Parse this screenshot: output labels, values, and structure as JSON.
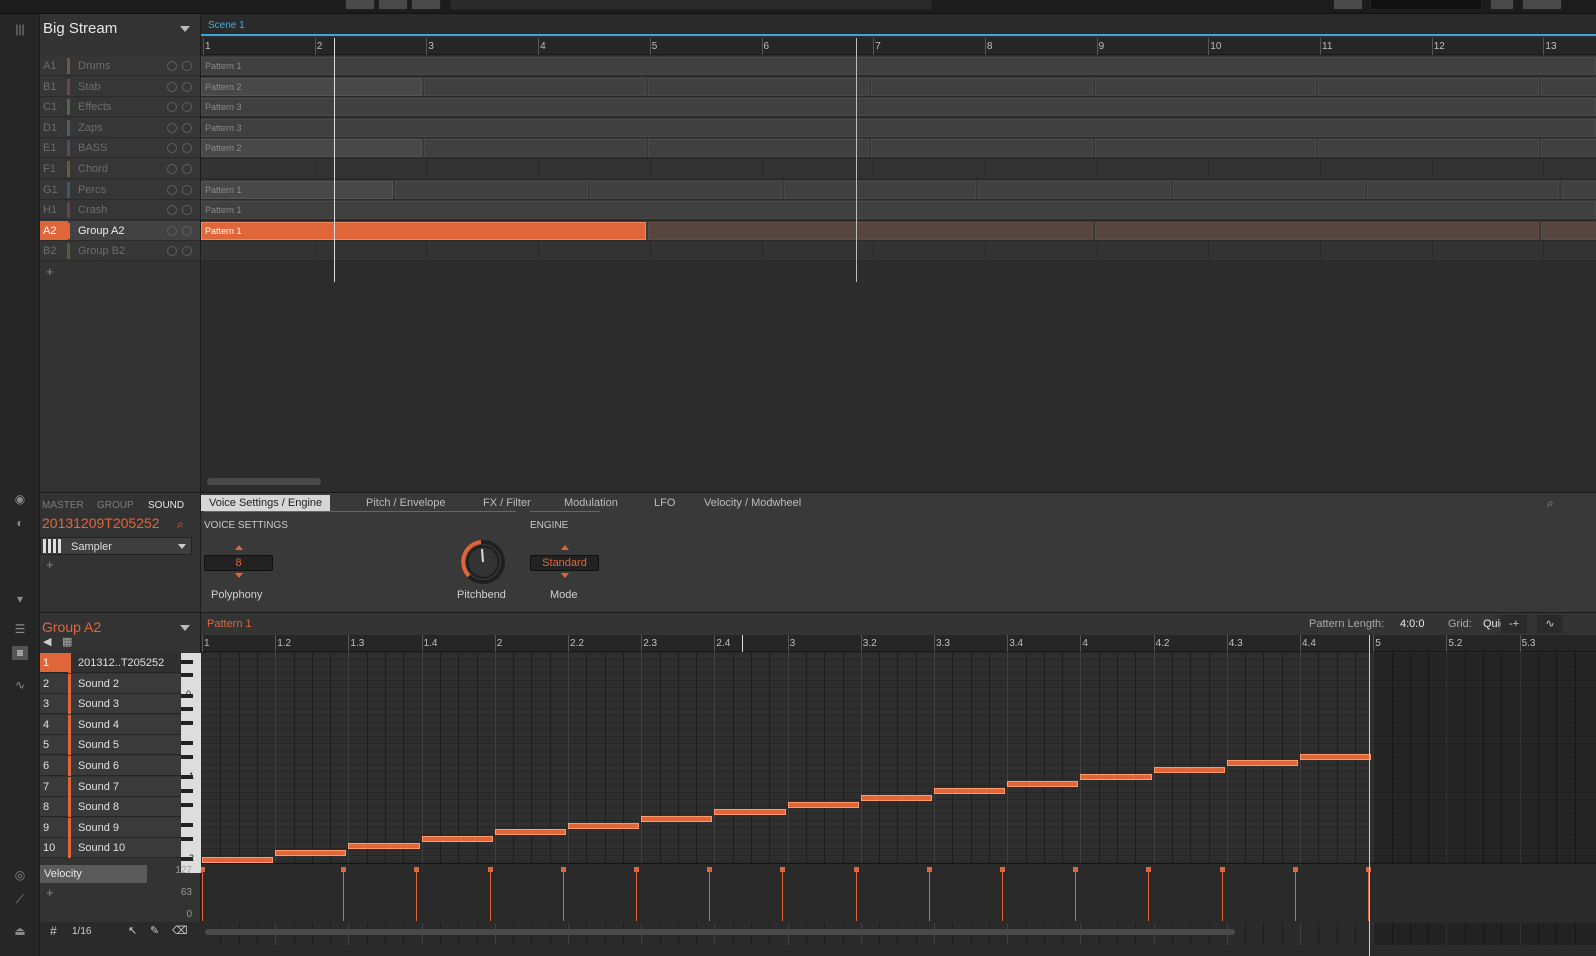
{
  "arranger": {
    "project_title": "Big Stream",
    "scene_label": "Scene 1",
    "bars": [
      "1",
      "2",
      "3",
      "4",
      "5",
      "6",
      "7",
      "8",
      "9",
      "10",
      "11",
      "12",
      "13"
    ],
    "groups": [
      {
        "id": "A1",
        "name": "Drums",
        "color": "#6b5a4a"
      },
      {
        "id": "B1",
        "name": "Stab",
        "color": "#6a4a44"
      },
      {
        "id": "C1",
        "name": "Effects",
        "color": "#4e6a4a"
      },
      {
        "id": "D1",
        "name": "Zaps",
        "color": "#4a5d6a"
      },
      {
        "id": "E1",
        "name": "BASS",
        "color": "#5a4a6a"
      },
      {
        "id": "F1",
        "name": "Chord",
        "color": "#6a5a3a"
      },
      {
        "id": "G1",
        "name": "Percs",
        "color": "#3a5a6a"
      },
      {
        "id": "H1",
        "name": "Crash",
        "color": "#5a4a4a"
      },
      {
        "id": "A2",
        "name": "Group A2",
        "color": "#e0663a"
      },
      {
        "id": "B2",
        "name": "Group B2",
        "color": "#5a5a3a"
      }
    ],
    "clips": [
      "Pattern 1",
      "Pattern 2",
      "Pattern 3",
      "Pattern 3",
      "Pattern 2",
      "",
      "Pattern 1",
      "Pattern 1",
      "Pattern 1",
      ""
    ]
  },
  "panel": {
    "tabs_left": [
      "MASTER",
      "GROUP",
      "SOUND"
    ],
    "sound_name": "20131209T205252",
    "plugin": "Sampler",
    "tabs": [
      "Voice Settings / Engine",
      "Pitch / Envelope",
      "FX / Filter",
      "Modulation",
      "LFO",
      "Velocity / Modwheel"
    ],
    "section_voice": "VOICE SETTINGS",
    "section_engine": "ENGINE",
    "polyphony_value": "8",
    "polyphony_label": "Polyphony",
    "pitchbend_label": "Pitchbend",
    "mode_value": "Standard",
    "mode_label": "Mode"
  },
  "pattern": {
    "group_name": "Group A2",
    "pattern_name": "Pattern 1",
    "pattern_length_label": "Pattern Length:",
    "pattern_length_value": "4:0:0",
    "grid_label": "Grid:",
    "grid_value": "Quick",
    "steps": [
      "1",
      "1.2",
      "1.3",
      "1.4",
      "2",
      "2.2",
      "2.3",
      "2.4",
      "3",
      "3.2",
      "3.3",
      "3.4",
      "4",
      "4.2",
      "4.3",
      "4.4",
      "5",
      "5.2",
      "5.3"
    ],
    "sounds": [
      "201312..T205252",
      "Sound 2",
      "Sound 3",
      "Sound 4",
      "Sound 5",
      "Sound 6",
      "Sound 7",
      "Sound 8",
      "Sound 9",
      "Sound 10"
    ],
    "sound_numbers": [
      "1",
      "2",
      "3",
      "4",
      "5",
      "6",
      "7",
      "8",
      "9",
      "10"
    ],
    "key_labels": [
      "0",
      "-1",
      "-2"
    ],
    "velocity_label": "Velocity",
    "velocity_scale": [
      "127",
      "63",
      "0"
    ],
    "grid_resolution": "1/16"
  },
  "colors": {
    "accent": "#e0663a",
    "scene": "#3fb0e0"
  }
}
